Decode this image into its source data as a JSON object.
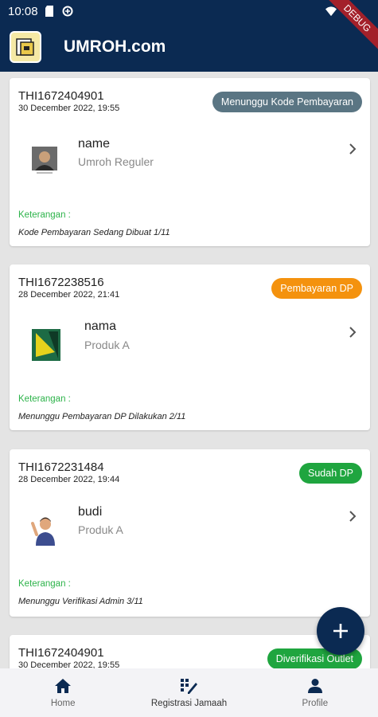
{
  "status_bar": {
    "time": "10:08"
  },
  "debug_banner": "DEBUG",
  "app_bar": {
    "title": "UMROH.com"
  },
  "cards": [
    {
      "code": "THI1672404901",
      "date": "30 December 2022, 19:55",
      "status": "Menunggu Kode Pembayaran",
      "status_color": "#5a7583",
      "name": "name",
      "product": "Umroh Reguler",
      "keterangan_label": "Keterangan :",
      "keterangan": "Kode Pembayaran Sedang Dibuat 1/11",
      "thumb_icon": "person-photo-icon"
    },
    {
      "code": "THI1672238516",
      "date": "28 December 2022, 21:41",
      "status": "Pembayaran DP",
      "status_color": "#f4920e",
      "name": "nama",
      "product": "Produk A",
      "keterangan_label": "Keterangan :",
      "keterangan": "Menunggu Pembayaran DP Dilakukan 2/11",
      "thumb_icon": "book-cover-icon"
    },
    {
      "code": "THI1672231484",
      "date": "28 December 2022, 19:44",
      "status": "Sudah DP",
      "status_color": "#1fa53f",
      "name": "budi",
      "product": "Produk A",
      "keterangan_label": "Keterangan :",
      "keterangan": "Menunggu Verifikasi Admin 3/11",
      "thumb_icon": "waving-person-icon"
    },
    {
      "code": "THI1672404901",
      "date": "30 December 2022, 19:55",
      "status": "Diverifikasi Outlet",
      "status_color": "#1fa53f"
    }
  ],
  "fab": {
    "icon": "plus-icon"
  },
  "bottom_nav": [
    {
      "label": "Home",
      "icon": "home-icon"
    },
    {
      "label": "Registrasi Jamaah",
      "icon": "registration-icon"
    },
    {
      "label": "Profile",
      "icon": "person-icon"
    }
  ],
  "colors": {
    "primary": "#0b2a52",
    "keterangan": "#2db34a"
  }
}
